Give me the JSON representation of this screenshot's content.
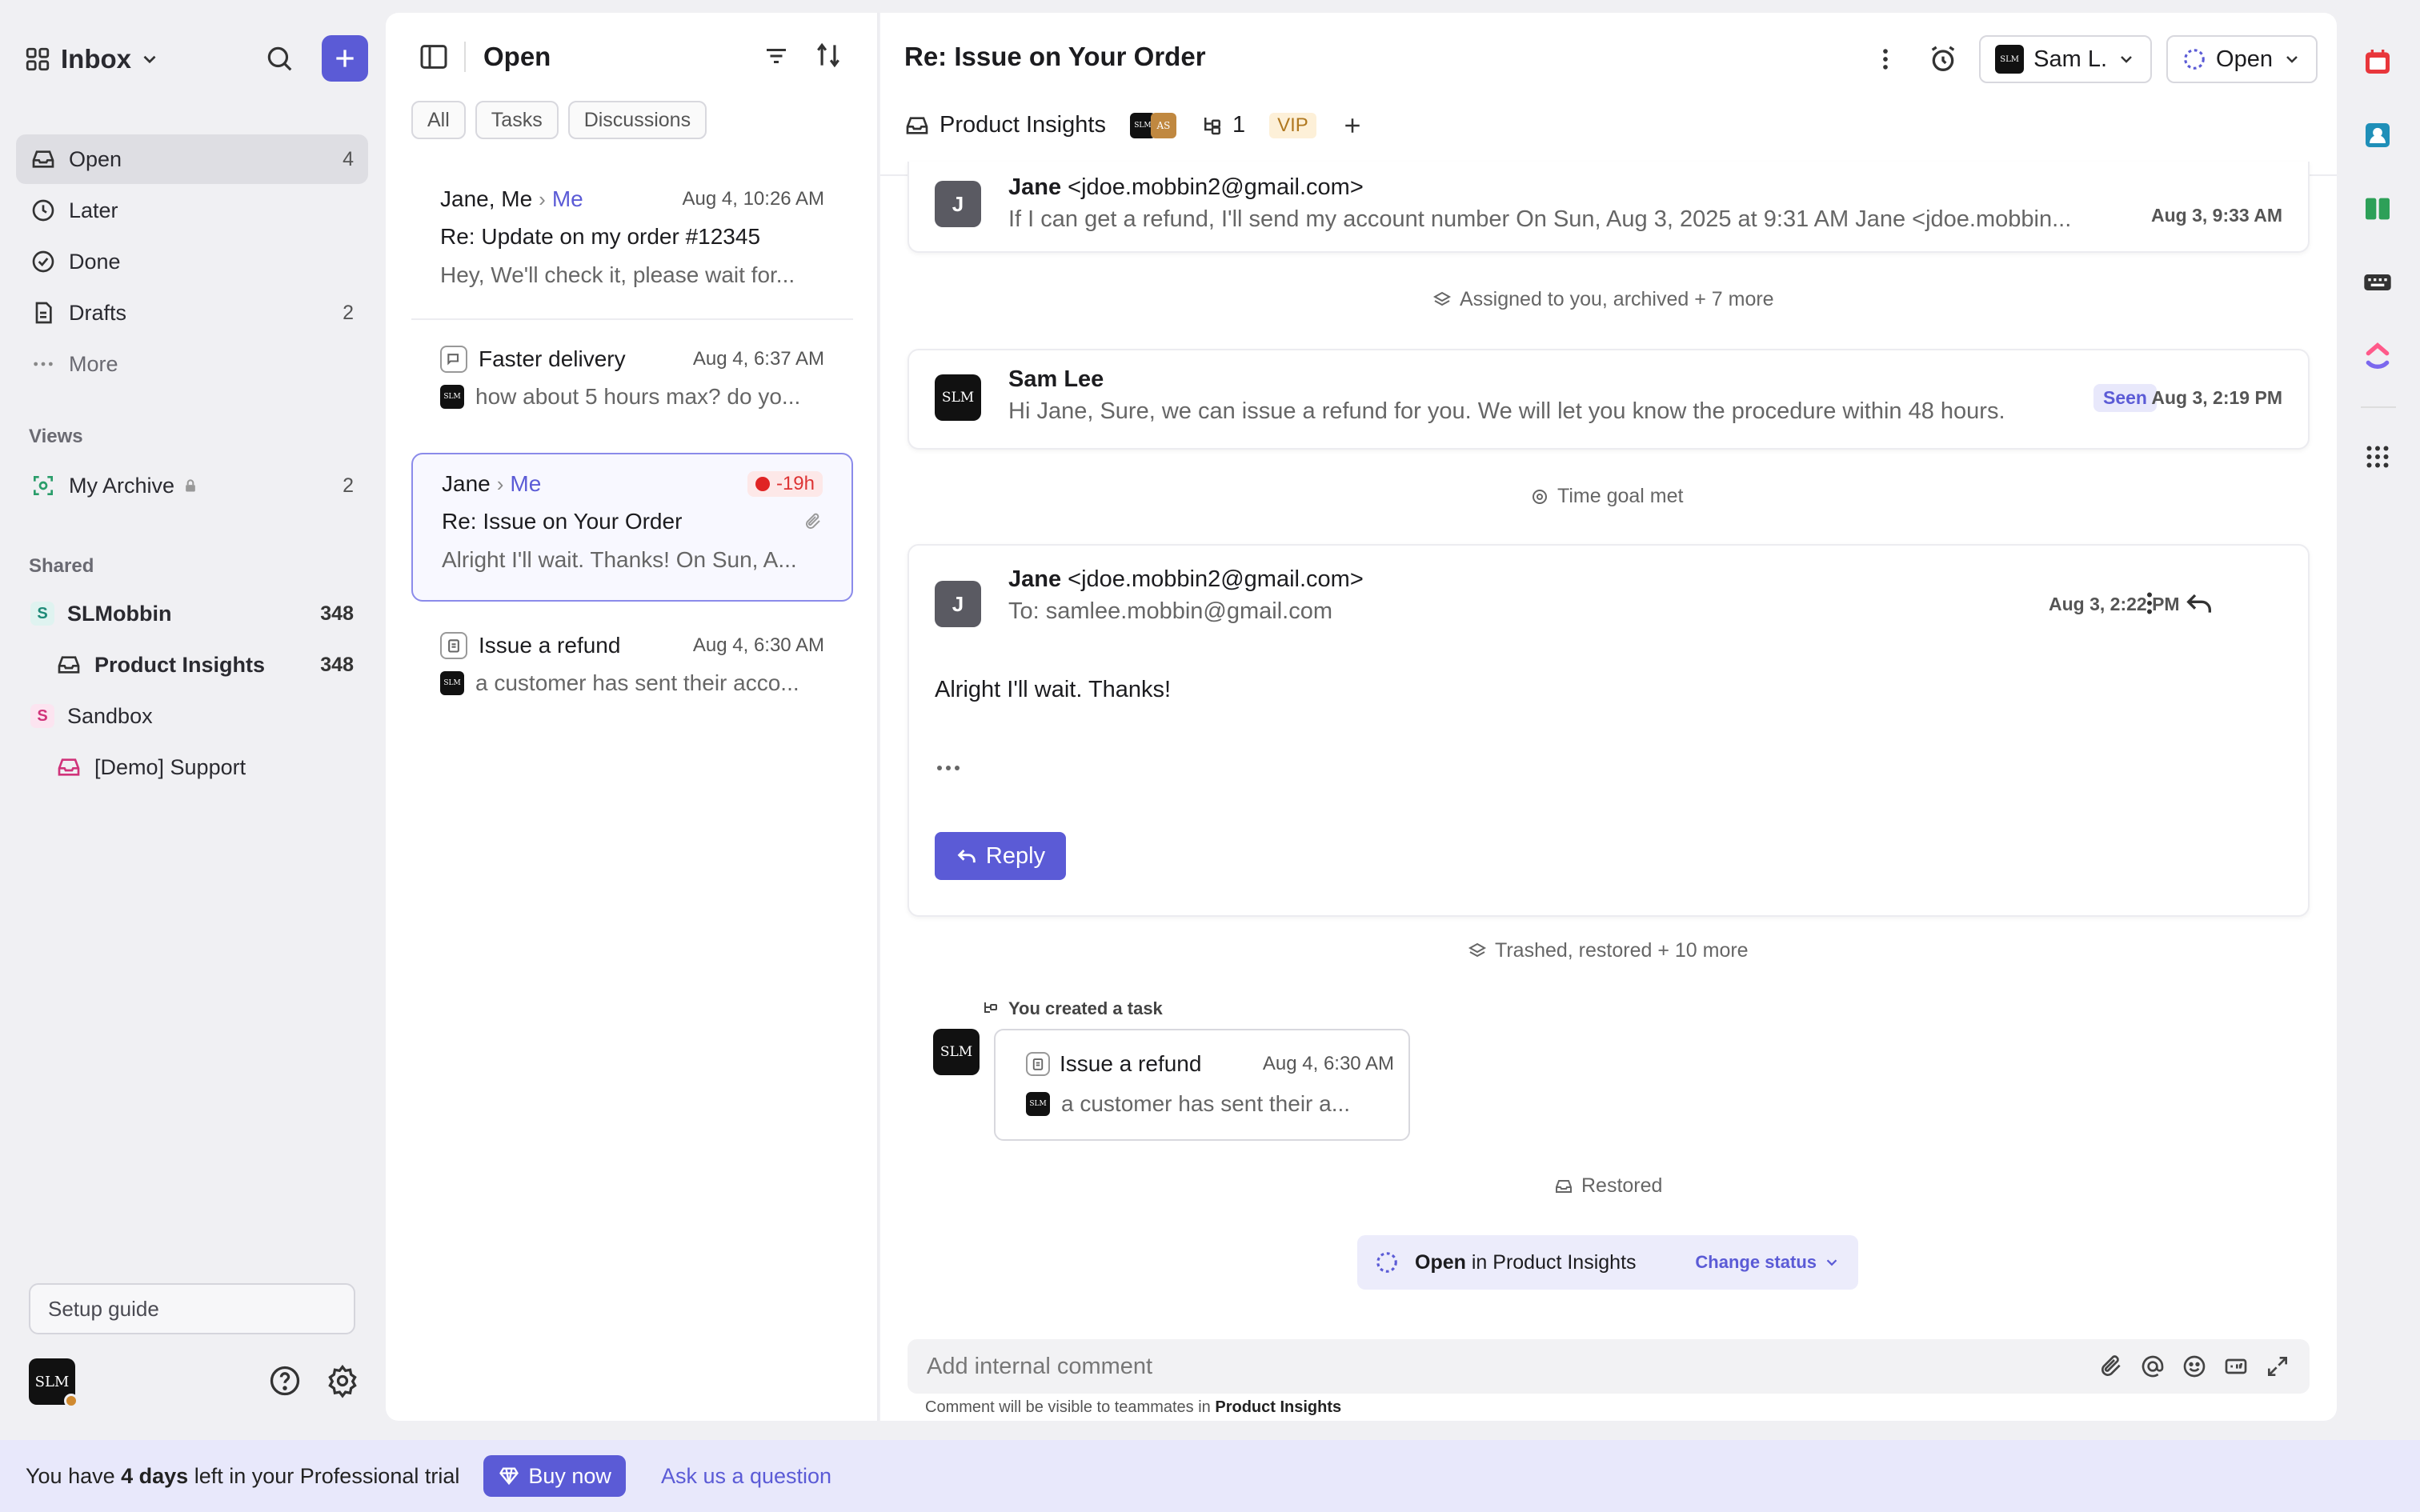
{
  "sidebar": {
    "workspace_title": "Inbox",
    "nav": [
      {
        "label": "Open",
        "count": "4"
      },
      {
        "label": "Later",
        "count": ""
      },
      {
        "label": "Done",
        "count": ""
      },
      {
        "label": "Drafts",
        "count": "2"
      },
      {
        "label": "More",
        "count": ""
      }
    ],
    "views_label": "Views",
    "views": [
      {
        "label": "My Archive",
        "count": "2"
      }
    ],
    "shared_label": "Shared",
    "shared": [
      {
        "label": "SLMobbin",
        "count": "348",
        "badge": "S"
      },
      {
        "label": "Product Insights",
        "count": "348"
      },
      {
        "label": "Sandbox",
        "count": "",
        "badge": "S"
      },
      {
        "label": "[Demo] Support",
        "count": ""
      }
    ],
    "setup_guide": "Setup guide",
    "avatar_text": "SLM"
  },
  "list": {
    "title": "Open",
    "chips": [
      "All",
      "Tasks",
      "Discussions"
    ],
    "conversations": [
      {
        "from": "Jane, Me",
        "to": "Me",
        "time": "Aug 4, 10:26 AM",
        "subject": "Re: Update on my order #12345",
        "preview": "Hey, We'll check it, please wait for..."
      },
      {
        "from": "Faster delivery",
        "time": "Aug 4, 6:37 AM",
        "preview": "how about 5 hours max? do yo..."
      },
      {
        "from": "Jane",
        "to": "Me",
        "late": "-19h",
        "subject": "Re: Issue on Your Order",
        "preview": "Alright I'll wait. Thanks! On Sun, A..."
      },
      {
        "from": "Issue a refund",
        "time": "Aug 4, 6:30 AM",
        "preview": "a customer has sent their acco..."
      }
    ]
  },
  "main": {
    "title": "Re: Issue on Your Order",
    "assignee": "Sam L.",
    "status": "Open",
    "tabs": {
      "inbox": "Product Insights",
      "avatars": [
        "SLM",
        "AS"
      ],
      "task_count": "1",
      "vip": "VIP"
    },
    "messages": [
      {
        "avatar": "J",
        "name": "Jane",
        "email": "<jdoe.mobbin2@gmail.com>",
        "snippet": "If I can get a refund, I'll send my account number On Sun, Aug 3, 2025 at 9:31 AM Jane <jdoe.mobbin...",
        "time": "Aug 3, 9:33 AM"
      },
      {
        "avatar": "SLM",
        "name": "Sam Lee",
        "snippet": "Hi Jane, Sure, we can issue a refund for you. We will let you know the procedure within 48 hours.",
        "seen": "Seen",
        "time": "Aug 3, 2:19 PM"
      },
      {
        "avatar": "J",
        "name": "Jane",
        "email": "<jdoe.mobbin2@gmail.com>",
        "to": "To: samlee.mobbin@gmail.com",
        "body": "Alright I'll wait. Thanks!",
        "time": "Aug 3, 2:22 PM",
        "reply_label": "Reply"
      }
    ],
    "events": {
      "assigned": "Assigned to you, archived + 7 more",
      "time_goal": "Time goal met",
      "trashed": "Trashed, restored + 10 more",
      "task_created": "You created a task",
      "restored": "Restored"
    },
    "task_card": {
      "title": "Issue a refund",
      "time": "Aug 4, 6:30 AM",
      "preview": "a customer has sent their a..."
    },
    "status_bar": {
      "status": "Open",
      "in_text": "in Product Insights",
      "change": "Change status"
    },
    "comment": {
      "placeholder": "Add internal comment",
      "note_prefix": "Comment will be visible to teammates in",
      "note_inbox": "Product Insights"
    }
  },
  "trial": {
    "prefix": "You have",
    "days": "4 days",
    "suffix": "left in your Professional trial",
    "buy": "Buy now",
    "ask": "Ask us a question"
  },
  "colors": {
    "accent": "#5b5bd6",
    "late": "#e02424",
    "vip_bg": "#fdf0d8"
  }
}
